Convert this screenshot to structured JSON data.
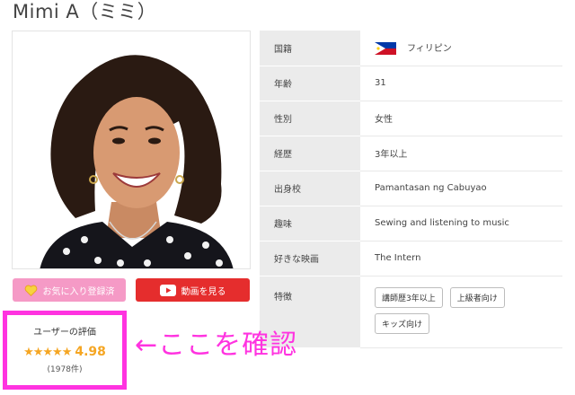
{
  "page": {
    "title": "Mimi A（ミミ）"
  },
  "buttons": {
    "favorite_label": "お気に入り登録済",
    "video_label": "動画を見る"
  },
  "profile": {
    "nationality_label": "国籍",
    "nationality_value": "フィリピン",
    "age_label": "年齢",
    "age_value": "31",
    "gender_label": "性別",
    "gender_value": "女性",
    "experience_label": "経歴",
    "experience_value": "3年以上",
    "school_label": "出身校",
    "school_value": "Pamantasan ng Cabuyao",
    "hobby_label": "趣味",
    "hobby_value": "Sewing and listening to music",
    "movie_label": "好きな映画",
    "movie_value": "The Intern",
    "features_label": "特徴",
    "features": [
      "講師歴3年以上",
      "上級者向け",
      "キッズ向け"
    ]
  },
  "rating": {
    "title": "ユーザーの評価",
    "stars": "★★★★★",
    "score": "4.98",
    "count": "(1978件)"
  },
  "annotation": {
    "text": "←ここを確認"
  },
  "colors": {
    "favorite": "#f59ac6",
    "video": "#e52d2d",
    "highlight": "#ff33e0",
    "star": "#f5a623"
  }
}
